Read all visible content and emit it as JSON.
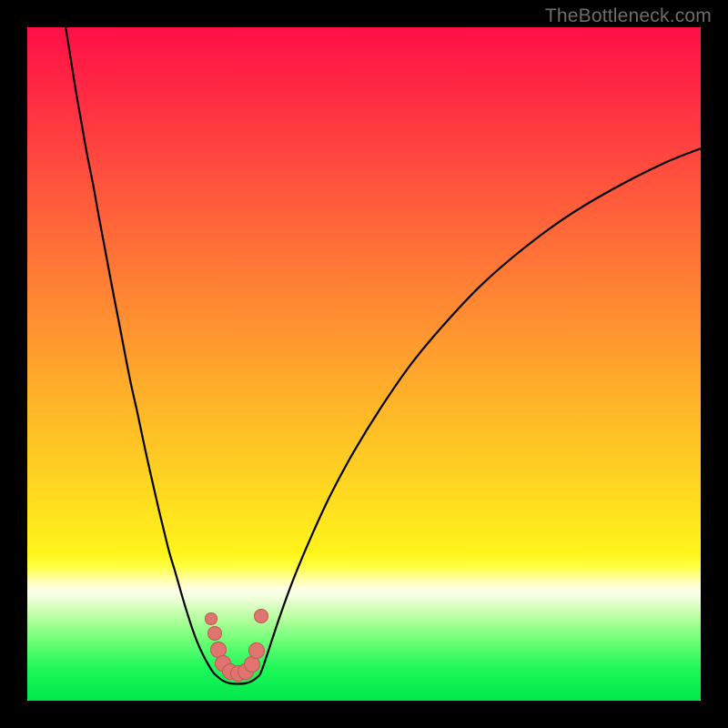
{
  "watermark": "TheBottleneck.com",
  "colors": {
    "frame": "#000000",
    "curve": "#000000",
    "marker_fill": "#e0746e",
    "marker_stroke": "#bd5b55"
  },
  "chart_data": {
    "type": "line",
    "title": "",
    "xlabel": "",
    "ylabel": "",
    "xlim": [
      0,
      100
    ],
    "ylim": [
      0,
      100
    ],
    "gradient_stops": [
      {
        "pos": 0.0,
        "color": "#ff1045"
      },
      {
        "pos": 0.1,
        "color": "#ff2b44"
      },
      {
        "pos": 0.25,
        "color": "#ff593c"
      },
      {
        "pos": 0.4,
        "color": "#ff8533"
      },
      {
        "pos": 0.55,
        "color": "#ffb229"
      },
      {
        "pos": 0.7,
        "color": "#ffdc1f"
      },
      {
        "pos": 0.78,
        "color": "#fff41a"
      },
      {
        "pos": 0.8,
        "color": "#ffff40"
      },
      {
        "pos": 0.82,
        "color": "#ffffa8"
      },
      {
        "pos": 0.835,
        "color": "#ffffe8"
      },
      {
        "pos": 0.845,
        "color": "#f5ffe0"
      },
      {
        "pos": 0.86,
        "color": "#d8ffc0"
      },
      {
        "pos": 0.88,
        "color": "#b0ff9a"
      },
      {
        "pos": 0.91,
        "color": "#70ff77"
      },
      {
        "pos": 0.95,
        "color": "#20f85a"
      },
      {
        "pos": 1.0,
        "color": "#00e84a"
      }
    ],
    "series": [
      {
        "name": "left_branch",
        "x": [
          5.7,
          6.5,
          7.3,
          8.1,
          8.9,
          9.8,
          10.6,
          11.4,
          12.2,
          13.0,
          13.8,
          14.6,
          15.4,
          16.3,
          17.1,
          17.9,
          18.7,
          19.5,
          20.3,
          21.1,
          22.0,
          22.8,
          23.6,
          24.4,
          25.2,
          26.0,
          26.8,
          27.6,
          28.0
        ],
        "y": [
          100.0,
          95.0,
          90.0,
          85.5,
          81.0,
          76.5,
          72.0,
          67.8,
          63.5,
          59.3,
          55.2,
          51.0,
          47.0,
          43.0,
          39.2,
          35.5,
          32.0,
          28.5,
          25.2,
          22.0,
          19.0,
          16.2,
          13.5,
          11.0,
          8.8,
          7.0,
          5.5,
          4.2,
          3.8
        ]
      },
      {
        "name": "right_branch",
        "x": [
          34.5,
          35.0,
          36.0,
          37.5,
          39.5,
          42.0,
          45.0,
          48.5,
          52.5,
          57.0,
          62.0,
          67.5,
          73.5,
          80.0,
          87.0,
          94.5,
          100.0
        ],
        "y": [
          3.8,
          5.0,
          8.0,
          12.5,
          18.0,
          24.0,
          30.5,
          37.0,
          43.5,
          50.0,
          56.0,
          61.8,
          67.0,
          71.8,
          76.0,
          79.8,
          82.0
        ]
      },
      {
        "name": "valley_floor",
        "x": [
          28.0,
          29.0,
          30.0,
          31.3,
          32.5,
          33.5,
          34.5
        ],
        "y": [
          3.8,
          3.0,
          2.6,
          2.5,
          2.6,
          3.0,
          3.8
        ]
      }
    ],
    "markers": [
      {
        "x": 27.3,
        "y": 12.2,
        "r": 7
      },
      {
        "x": 27.8,
        "y": 10.0,
        "r": 8
      },
      {
        "x": 28.4,
        "y": 7.6,
        "r": 9
      },
      {
        "x": 29.1,
        "y": 5.6,
        "r": 9
      },
      {
        "x": 30.1,
        "y": 4.3,
        "r": 9
      },
      {
        "x": 31.3,
        "y": 4.0,
        "r": 9
      },
      {
        "x": 32.4,
        "y": 4.3,
        "r": 9
      },
      {
        "x": 33.4,
        "y": 5.4,
        "r": 9
      },
      {
        "x": 34.0,
        "y": 7.4,
        "r": 9
      },
      {
        "x": 34.7,
        "y": 12.6,
        "r": 8
      }
    ]
  }
}
